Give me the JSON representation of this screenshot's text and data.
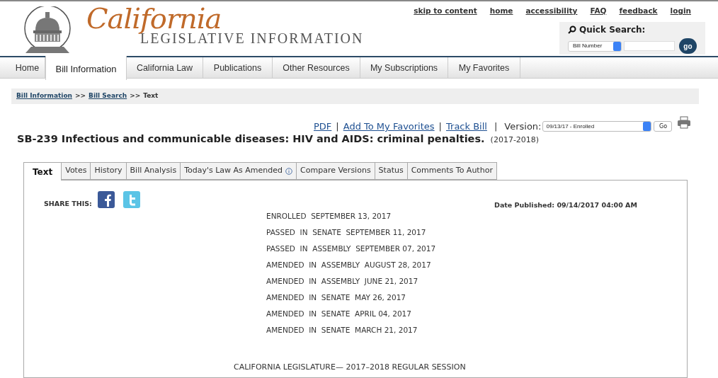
{
  "header": {
    "logo_script": "California",
    "logo_subtitle": "LEGISLATIVE INFORMATION",
    "top_links": [
      "skip to content",
      "home",
      "accessibility",
      "FAQ",
      "feedback",
      "login"
    ],
    "quick_search": {
      "label": "Quick Search:",
      "select": "Bill Number",
      "button": "go"
    }
  },
  "nav_tabs": [
    {
      "label": "Home",
      "selected": false
    },
    {
      "label": "Bill Information",
      "selected": true
    },
    {
      "label": "California Law",
      "selected": false
    },
    {
      "label": "Publications",
      "selected": false
    },
    {
      "label": "Other Resources",
      "selected": false
    },
    {
      "label": "My Subscriptions",
      "selected": false
    },
    {
      "label": "My Favorites",
      "selected": false
    }
  ],
  "breadcrumb": {
    "separator": ">>",
    "items": [
      {
        "label": "Bill Information",
        "link": true
      },
      {
        "label": "Bill Search",
        "link": true
      },
      {
        "label": "Text",
        "link": false
      }
    ]
  },
  "actions": {
    "links": [
      "PDF",
      "Add To My Favorites",
      "Track Bill"
    ],
    "separator": "|",
    "version_label": "Version:",
    "version_value": "09/13/17 - Enrolled",
    "go": "Go"
  },
  "bill": {
    "title": "SB-239 Infectious and communicable diseases: HIV and AIDS: criminal penalties.",
    "session": "(2017-2018)"
  },
  "bill_tabs": [
    {
      "label": "Text",
      "selected": true,
      "info": false
    },
    {
      "label": "Votes",
      "selected": false,
      "info": false
    },
    {
      "label": "History",
      "selected": false,
      "info": false
    },
    {
      "label": "Bill Analysis",
      "selected": false,
      "info": false
    },
    {
      "label": "Today's Law As Amended",
      "selected": false,
      "info": true
    },
    {
      "label": "Compare Versions",
      "selected": false,
      "info": false
    },
    {
      "label": "Status",
      "selected": false,
      "info": false
    },
    {
      "label": "Comments To Author",
      "selected": false,
      "info": false
    }
  ],
  "share_label": "SHARE THIS:",
  "date_published": "Date Published: 09/14/2017 04:00 AM",
  "history": [
    "ENROLLED  SEPTEMBER 13, 2017",
    "PASSED  IN  SENATE  SEPTEMBER 11, 2017",
    "PASSED  IN  ASSEMBLY  SEPTEMBER 07, 2017",
    "AMENDED  IN  ASSEMBLY  AUGUST 28, 2017",
    "AMENDED  IN  ASSEMBLY  JUNE 21, 2017",
    "AMENDED  IN  SENATE  MAY 26, 2017",
    "AMENDED  IN  SENATE  APRIL 04, 2017",
    "AMENDED  IN  SENATE  MARCH 21, 2017"
  ],
  "footer_text": "CALIFORNIA LEGISLATURE— 2017–2018 REGULAR SESSION"
}
